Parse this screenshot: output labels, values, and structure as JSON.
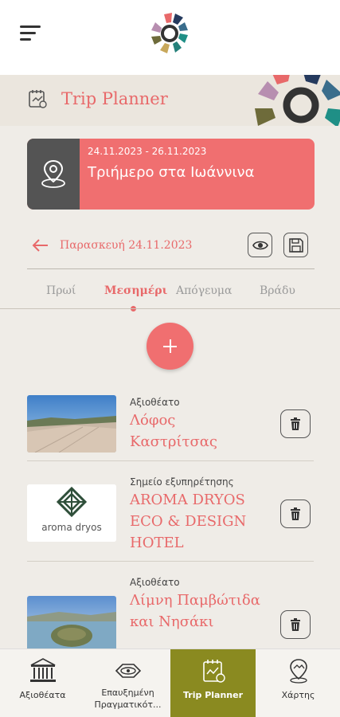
{
  "header": {
    "title": "Trip Planner"
  },
  "trip": {
    "dates": "24.11.2023 - 26.11.2023",
    "name": "Τριήμερο στα Ιωάννινα"
  },
  "day": {
    "label": "Παρασκευή 24.11.2023"
  },
  "tabs": [
    {
      "label": "Πρωί",
      "active": false
    },
    {
      "label": "Μεσημέρι",
      "active": true
    },
    {
      "label": "Απόγευμα",
      "active": false
    },
    {
      "label": "Βράδυ",
      "active": false
    }
  ],
  "items": [
    {
      "category": "Αξιοθέατο",
      "name": "Λόφος Καστρίτσας"
    },
    {
      "category": "Σημείο εξυπηρέτησης",
      "name": "AROMA DRYOS ECO & DESIGN HOTEL",
      "logo_text": "aroma dryos"
    },
    {
      "category": "Αξιοθέατο",
      "name": "Λίμνη Παμβώτιδα και Νησάκι"
    }
  ],
  "bottom_nav": [
    {
      "label": "Αξιοθέατα",
      "icon": "monument-icon",
      "active": false
    },
    {
      "label": "Επαυξημένη Πραγματικότ...",
      "icon": "ar-glasses-icon",
      "active": false
    },
    {
      "label": "Trip Planner",
      "icon": "trip-planner-icon",
      "active": true
    },
    {
      "label": "Χάρτης",
      "icon": "map-pin-icon",
      "active": false
    }
  ],
  "colors": {
    "accent": "#f06f70",
    "pin_bg": "#545454",
    "nav_active": "#8a8a20"
  }
}
